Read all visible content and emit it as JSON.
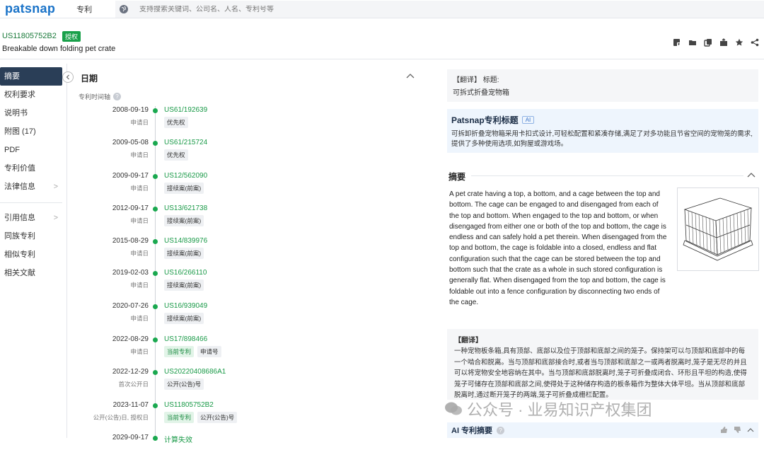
{
  "app": {
    "logo": "patsnap",
    "module": "专利",
    "search_placeholder": "支持搜索关键词、公司名、人名、专利号等"
  },
  "patent": {
    "number": "US11805752B2",
    "status_badge": "授权",
    "title": "Breakable down folding pet crate",
    "toolbar_icons": [
      "pdf-icon",
      "folder-icon",
      "copy-icon",
      "export-icon",
      "star-icon",
      "share-icon"
    ]
  },
  "nav": {
    "items": [
      {
        "label": "摘要",
        "active": true
      },
      {
        "label": "权利要求"
      },
      {
        "label": "说明书"
      },
      {
        "label": "附图 (17)"
      },
      {
        "label": "PDF"
      },
      {
        "label": "专利价值"
      },
      {
        "label": "法律信息",
        "chevron": ">"
      }
    ],
    "items2": [
      {
        "label": "引用信息",
        "chevron": ">"
      },
      {
        "label": "同族专利"
      },
      {
        "label": "相似专利"
      },
      {
        "label": "相关文献"
      }
    ]
  },
  "timeline": {
    "title": "日期",
    "subtitle": "专利时间轴",
    "events": [
      {
        "date": "2008-09-19",
        "type": "申请日",
        "number": "US61/192639",
        "tags": [
          {
            "text": "优先权",
            "green": false
          }
        ]
      },
      {
        "date": "2009-05-08",
        "type": "申请日",
        "number": "US61/215724",
        "tags": [
          {
            "text": "优先权",
            "green": false
          }
        ]
      },
      {
        "date": "2009-09-17",
        "type": "申请日",
        "number": "US12/562090",
        "tags": [
          {
            "text": "接续案(前案)",
            "green": false
          }
        ]
      },
      {
        "date": "2012-09-17",
        "type": "申请日",
        "number": "US13/621738",
        "tags": [
          {
            "text": "接续案(前案)",
            "green": false
          }
        ]
      },
      {
        "date": "2015-08-29",
        "type": "申请日",
        "number": "US14/839976",
        "tags": [
          {
            "text": "接续案(前案)",
            "green": false
          }
        ]
      },
      {
        "date": "2019-02-03",
        "type": "申请日",
        "number": "US16/266110",
        "tags": [
          {
            "text": "接续案(前案)",
            "green": false
          }
        ]
      },
      {
        "date": "2020-07-26",
        "type": "申请日",
        "number": "US16/939049",
        "tags": [
          {
            "text": "接续案(前案)",
            "green": false
          }
        ]
      },
      {
        "date": "2022-08-29",
        "type": "申请日",
        "number": "US17/898466",
        "tags": [
          {
            "text": "当前专利",
            "green": true
          },
          {
            "text": "申请号",
            "green": false
          }
        ]
      },
      {
        "date": "2022-12-29",
        "type": "首次公开日",
        "number": "US20220408686A1",
        "tags": [
          {
            "text": "公开(公告)号",
            "green": false
          }
        ]
      },
      {
        "date": "2023-11-07",
        "type": "公开(公告)日, 授权日",
        "number": "US11805752B2",
        "tags": [
          {
            "text": "当前专利",
            "green": true
          },
          {
            "text": "公开(公告)号",
            "green": false
          }
        ]
      },
      {
        "date": "2029-09-17",
        "type": "",
        "number": "计算失效",
        "tags": []
      }
    ]
  },
  "right": {
    "translated_title_label": "【翻译】 标题:",
    "translated_title": "可拆式折叠宠物箱",
    "patsnap_title_label": "Patsnap专利标题",
    "ai_badge": "AI",
    "patsnap_title_text": "可拆卸折叠宠物箱采用卡扣式设计,可轻松配置和紧凑存储,满足了对多功能且节省空间的宠物笼的需求,提供了多种使用选项,如狗屋或游戏场。",
    "abstract_title": "摘要",
    "abstract_text": "A pet crate having a top, a bottom, and a cage between the top and bottom. The cage can be engaged to and disengaged from each of the top and bottom. When engaged to the top and bottom, or when disengaged from either one or both of the top and bottom, the cage is endless and can safely hold a pet therein. When disengaged from the top and bottom, the cage is foldable into a closed, endless and flat configuration such that the cage can be stored between the top and bottom such that the crate as a whole in such stored configuration is generally flat. When disengaged from the top and bottom, the cage is foldable out into a fence configuration by disconnecting two ends of the cage.",
    "translation_label": "【翻译】",
    "translation_text": "一种宠物板条箱,具有顶部、底部以及位于顶部和底部之间的笼子。保持架可以与顶部和底部中的每一个啮合和脱离。当与顶部和底部接合时,或者当与顶部和底部之一或两者脱离时,笼子是无尽的并且可以将宠物安全地容纳在其中。当与顶部和底部脱离时,笼子可折叠成闭合、环形且平坦的构造,使得笼子可储存在顶部和底部之间,使得处于这种储存构造的板条箱作为整体大体平坦。当从顶部和底部脱离时,通过断开笼子的两端,笼子可折叠成栅栏配置。",
    "ai_abstract_label": "AI 专利摘要"
  },
  "watermark": "公众号 · 业易知识产权集团",
  "colors": {
    "brand_blue": "#1a73c8",
    "green": "#1aa84f",
    "nav_active": "#2a3e57"
  }
}
